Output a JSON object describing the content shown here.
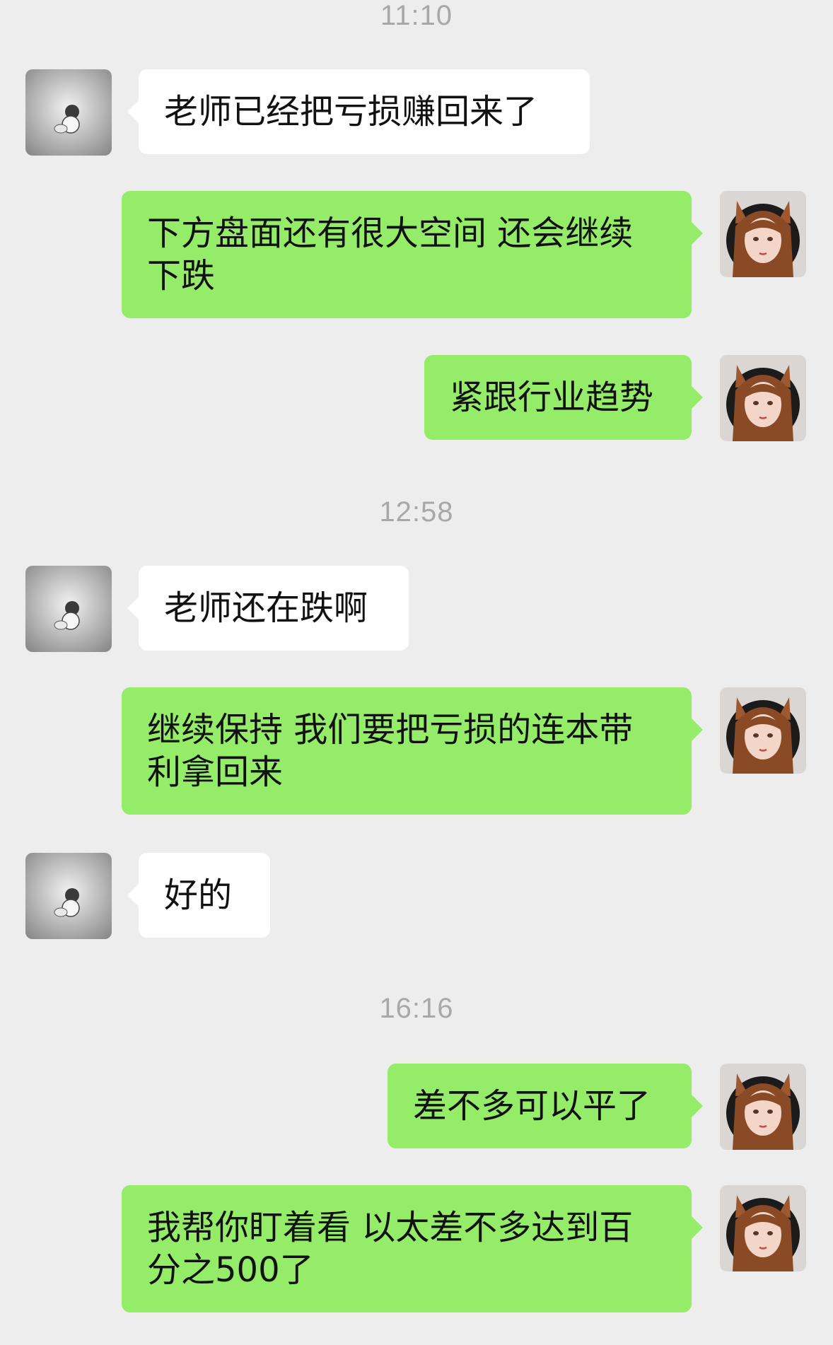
{
  "timestamps": [
    "11:10",
    "12:58",
    "16:16"
  ],
  "messages": [
    {
      "side": "in",
      "text": "老师已经把亏损赚回来了"
    },
    {
      "side": "out",
      "text": "下方盘面还有很大空间 还会继续下跌"
    },
    {
      "side": "out",
      "text": "紧跟行业趋势"
    },
    {
      "side": "in",
      "text": "老师还在跌啊"
    },
    {
      "side": "out",
      "text": "继续保持 我们要把亏损的连本带利拿回来"
    },
    {
      "side": "in",
      "text": "好的"
    },
    {
      "side": "out",
      "text": "差不多可以平了"
    },
    {
      "side": "out",
      "text": "我帮你盯着看 以太差不多达到百分之500了"
    }
  ],
  "colors": {
    "background": "#ededed",
    "incoming_bubble": "#ffffff",
    "outgoing_bubble": "#95ec69",
    "timestamp_text": "#a8a8a8"
  },
  "icons": {
    "incoming_avatar": "bear-avatar-icon",
    "outgoing_avatar": "fox-girl-avatar-icon"
  }
}
